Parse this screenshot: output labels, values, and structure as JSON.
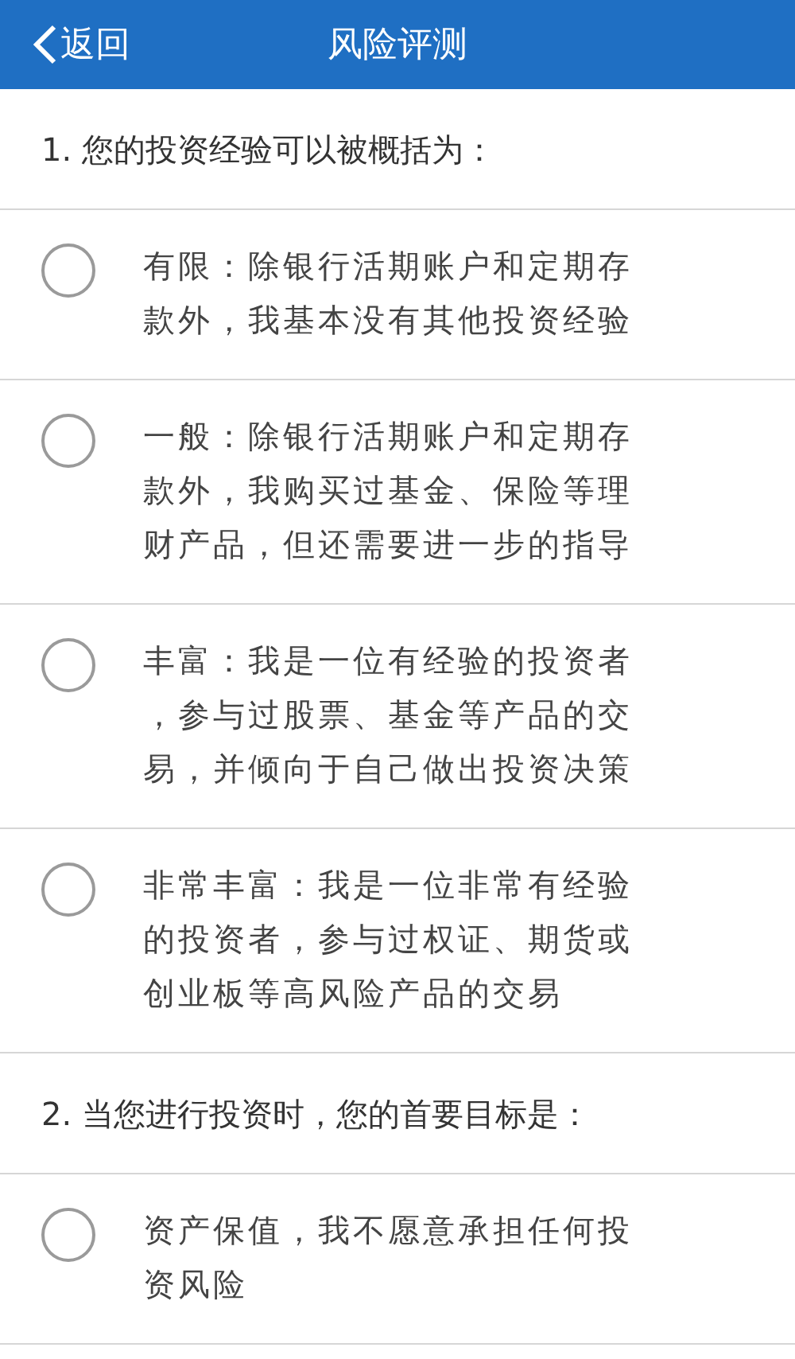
{
  "header": {
    "back": "返回",
    "title": "风险评测"
  },
  "questions": [
    {
      "title": "1. 您的投资经验可以被概括为：",
      "options": [
        {
          "text": "有限：除银行活期账户和定期存款外，我基本没有其他投资经验",
          "selected": false
        },
        {
          "text": "一般：除银行活期账户和定期存款外，我购买过基金、保险等理财产品，但还需要进一步的指导",
          "selected": false
        },
        {
          "text": "丰富：我是一位有经验的投资者，参与过股票、基金等产品的交易，并倾向于自己做出投资决策",
          "selected": false
        },
        {
          "text": "非常丰富：我是一位非常有经验的投资者，参与过权证、期货或创业板等高风险产品的交易",
          "selected": false
        }
      ]
    },
    {
      "title": "2. 当您进行投资时，您的首要目标是：",
      "options": [
        {
          "text": "资产保值，我不愿意承担任何投资风险",
          "selected": false
        }
      ]
    }
  ]
}
